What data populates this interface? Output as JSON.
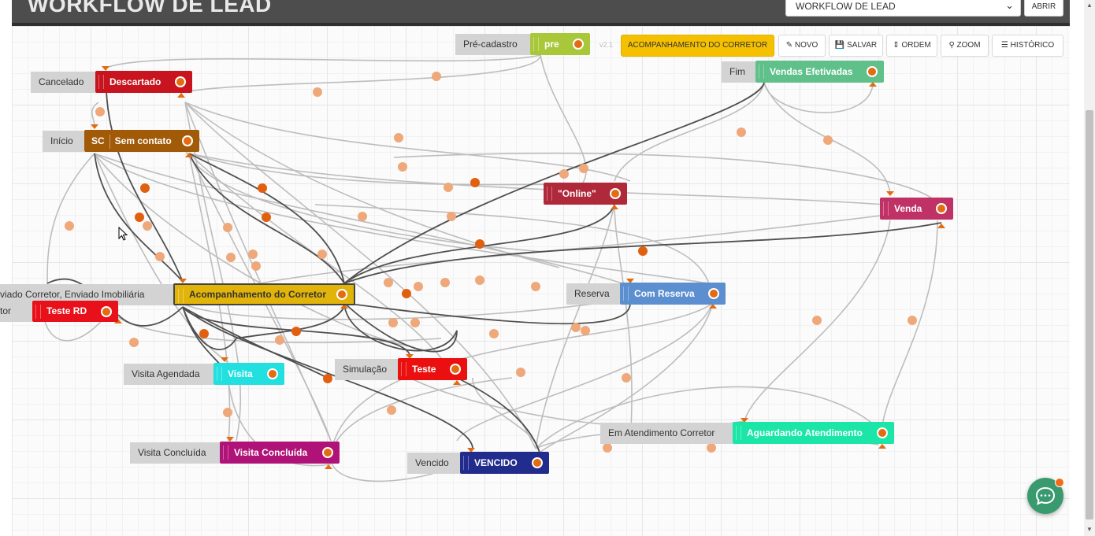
{
  "header": {
    "title": "WORKFLOW DE LEAD",
    "select_value": "WORKFLOW DE LEAD",
    "open_label": "ABRIR"
  },
  "toolbar": {
    "version": "v2.1",
    "current_flow": "ACOMPANHAMENTO DO CORRETOR",
    "novo": "NOVO",
    "salvar": "SALVAR",
    "ordem": "ORDEM",
    "zoom": "ZOOM",
    "historico": "HISTÓRICO"
  },
  "nodes": [
    {
      "id": "pre",
      "label": "Pré-cadastro",
      "name": "pre",
      "color": "#a8c83a"
    },
    {
      "id": "descartado",
      "label": "Cancelado",
      "name": "Descartado",
      "color": "#c8141e"
    },
    {
      "id": "vendas",
      "label": "Fim",
      "name": "Vendas Efetivadas",
      "color": "#5fc08a"
    },
    {
      "id": "semcontato",
      "label": "Início",
      "code": "SC",
      "name": "Sem contato",
      "color": "#a15a08"
    },
    {
      "id": "online",
      "label": "",
      "name": "\"Online\"",
      "color": "#b0293a"
    },
    {
      "id": "venda",
      "label": "",
      "name": "Venda",
      "color": "#c03266"
    },
    {
      "id": "acomp",
      "label": "viado Corretor, Enviado Imobiliária",
      "name": "Acompanhamento do Corretor",
      "color": "#e2b40a"
    },
    {
      "id": "testerd",
      "label": "tor",
      "name": "Teste RD",
      "color": "#e8101a"
    },
    {
      "id": "reserva",
      "label": "Reserva",
      "name": "Com Reserva",
      "color": "#5b8fd0"
    },
    {
      "id": "visita",
      "label": "Visita Agendada",
      "name": "Visita",
      "color": "#22e0e0"
    },
    {
      "id": "teste",
      "label": "Simulação",
      "name": "Teste",
      "color": "#ea1010"
    },
    {
      "id": "concluida",
      "label": "Visita Concluída",
      "name": "Visita Concluída",
      "color": "#b01378"
    },
    {
      "id": "vencido",
      "label": "Vencido",
      "name": "VENCIDO",
      "color": "#222c8c"
    },
    {
      "id": "aguardando",
      "label": "Em Atendimento Corretor",
      "name": "Aguardando Atendimento",
      "color": "#1be6a8"
    }
  ],
  "colors": {
    "edge": "#bdbdbd",
    "edge_active": "#555555",
    "dot": "#eea87a",
    "dot_active": "#e06010",
    "port": "#e36b10"
  }
}
